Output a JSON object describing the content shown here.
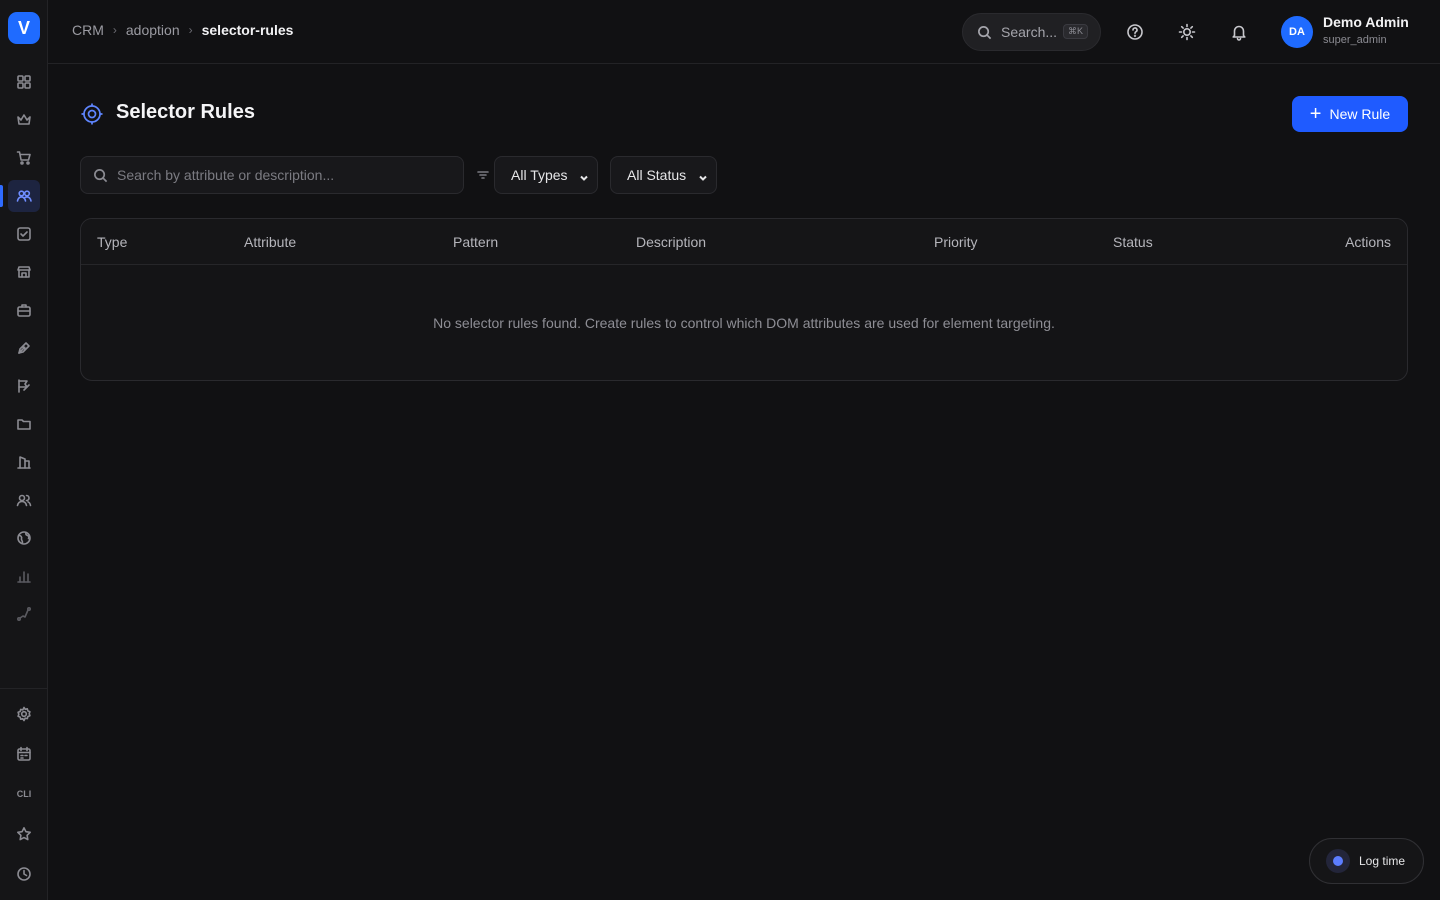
{
  "brand": {
    "logo_letter": "V",
    "accent": "#1f6bff"
  },
  "sidebar": {
    "items": [
      {
        "name": "dashboard-icon"
      },
      {
        "name": "crown-icon"
      },
      {
        "name": "cart-icon"
      },
      {
        "name": "users-icon",
        "active": true
      },
      {
        "name": "checkbox-icon"
      },
      {
        "name": "store-icon"
      },
      {
        "name": "briefcase-icon"
      },
      {
        "name": "pen-icon"
      },
      {
        "name": "campaign-icon"
      },
      {
        "name": "folder-icon"
      },
      {
        "name": "building-icon"
      },
      {
        "name": "team-icon"
      },
      {
        "name": "globe-icon"
      },
      {
        "name": "bar-chart-icon"
      },
      {
        "name": "trend-icon"
      }
    ],
    "bottom_items": [
      {
        "name": "settings-icon"
      },
      {
        "name": "calendar-icon"
      },
      {
        "name": "cli-label",
        "label": "CLI"
      },
      {
        "name": "star-icon"
      },
      {
        "name": "clock-icon"
      }
    ]
  },
  "breadcrumb": {
    "items": [
      "CRM",
      "adoption"
    ],
    "current": "selector-rules"
  },
  "header": {
    "search_label": "Search...",
    "search_shortcut": "⌘K",
    "user": {
      "initials": "DA",
      "name": "Demo Admin",
      "role": "super_admin"
    }
  },
  "page": {
    "title": "Selector Rules",
    "new_button_label": "New Rule",
    "search_placeholder": "Search by attribute or description...",
    "type_filter": "All Types",
    "status_filter": "All Status"
  },
  "table": {
    "columns": [
      "Type",
      "Attribute",
      "Pattern",
      "Description",
      "Priority",
      "Status",
      "Actions"
    ],
    "empty_message": "No selector rules found. Create rules to control which DOM attributes are used for element targeting."
  },
  "log_time": {
    "label": "Log time"
  }
}
